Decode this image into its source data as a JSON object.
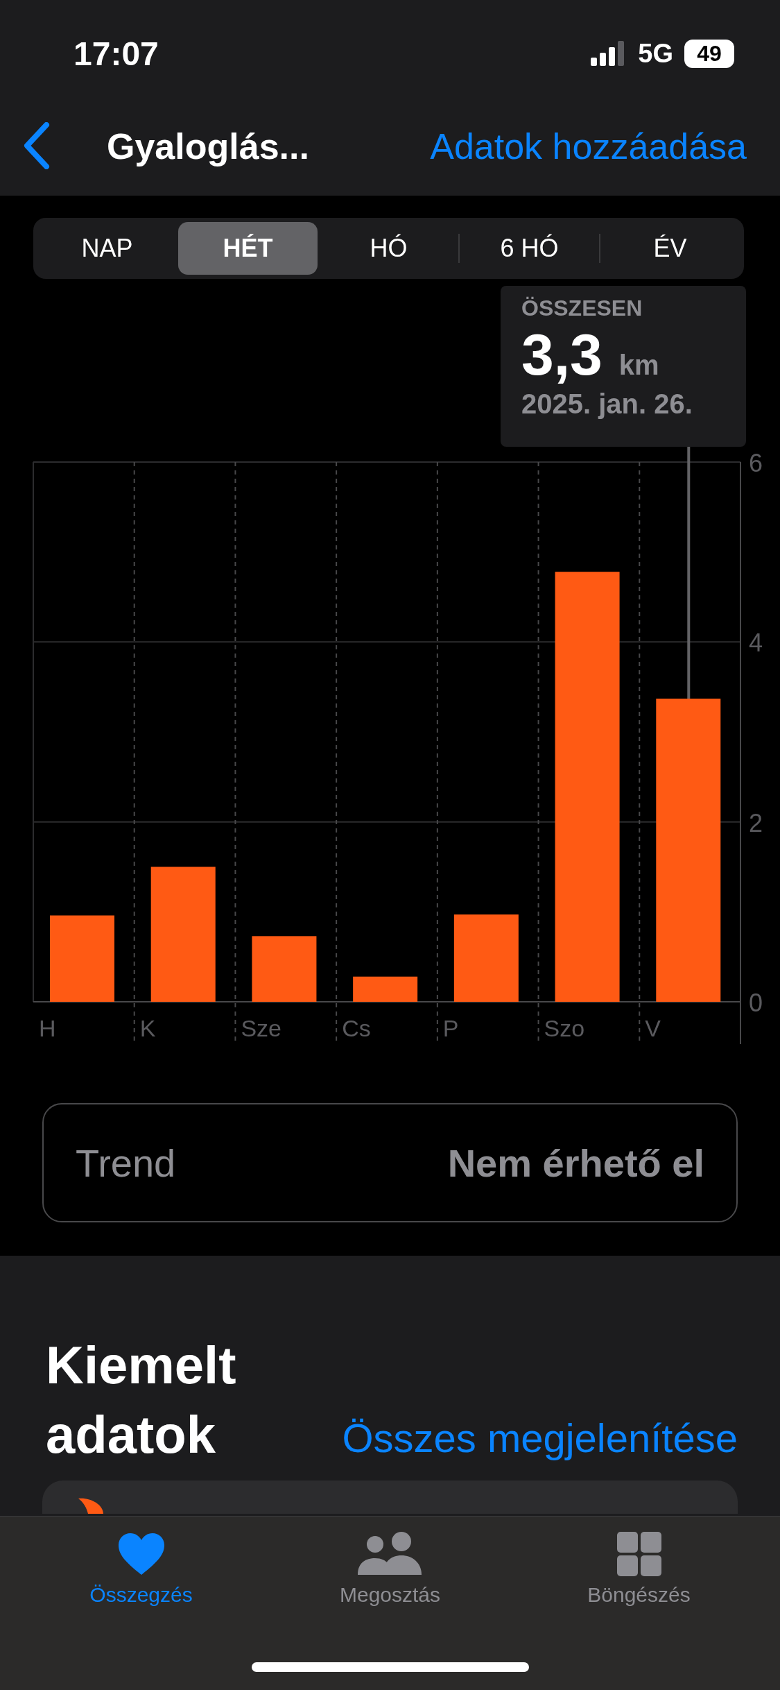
{
  "status_bar": {
    "time": "17:07",
    "network": "5G",
    "battery": "49"
  },
  "nav": {
    "title": "Gyaloglás...",
    "action": "Adatok hozzáadása"
  },
  "periods": [
    {
      "label": "NAP",
      "selected": false
    },
    {
      "label": "HÉT",
      "selected": true
    },
    {
      "label": "HÓ",
      "selected": false
    },
    {
      "label": "6 HÓ",
      "selected": false
    },
    {
      "label": "ÉV",
      "selected": false
    }
  ],
  "tooltip": {
    "label": "ÖSSZESEN",
    "value": "3,3",
    "unit": "km",
    "date": "2025. jan. 26."
  },
  "chart_data": {
    "type": "bar",
    "categories": [
      "H",
      "K",
      "Sze",
      "Cs",
      "P",
      "Szo",
      "V"
    ],
    "series": [
      {
        "color": "#ff5a14",
        "values": [
          0.96,
          1.5,
          0.73,
          0.28,
          0.97,
          4.78,
          3.37
        ]
      }
    ],
    "ylim": [
      0,
      6
    ],
    "yticks": [
      0,
      2,
      4,
      6
    ]
  },
  "trend": {
    "label": "Trend",
    "value": "Nem érhető el"
  },
  "highlights": {
    "title": "Kiemelt adatok",
    "link": "Összes megjelenítése"
  },
  "tab_bar": [
    {
      "label": "Összegzés",
      "selected": true,
      "kind": "heart"
    },
    {
      "label": "Megosztás",
      "selected": false,
      "kind": "people"
    },
    {
      "label": "Böngészés",
      "selected": false,
      "kind": "grid"
    }
  ]
}
